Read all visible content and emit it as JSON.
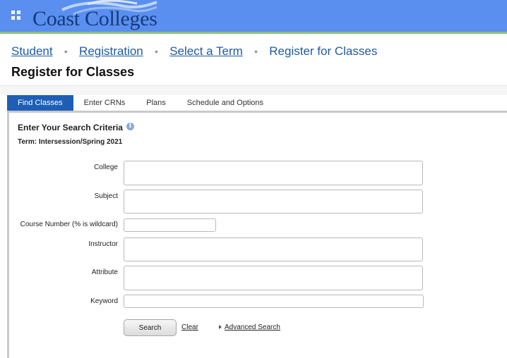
{
  "header": {
    "logo_text": "Coast Colleges",
    "icons": {
      "apps": "grid-apps-icon",
      "logo": "waves-logo-icon"
    },
    "colors": {
      "bar": "#5a8ff0",
      "stripe": "#8fc07a",
      "logo_text": "#163a7a"
    }
  },
  "breadcrumb": {
    "items": [
      "Student",
      "Registration",
      "Select a Term"
    ],
    "current": "Register for Classes"
  },
  "page": {
    "title": "Register for Classes"
  },
  "tabs": [
    {
      "label": "Find Classes",
      "active": true
    },
    {
      "label": "Enter CRNs",
      "active": false
    },
    {
      "label": "Plans",
      "active": false
    },
    {
      "label": "Schedule and Options",
      "active": false
    }
  ],
  "search": {
    "title": "Enter Your Search Criteria",
    "info_icon": "info-icon",
    "term": "Term: Intersession/Spring 2021",
    "fields": {
      "college": {
        "label": "College",
        "value": ""
      },
      "subject": {
        "label": "Subject",
        "value": ""
      },
      "course_number": {
        "label": "Course Number (% is wildcard)",
        "value": ""
      },
      "instructor": {
        "label": "Instructor",
        "value": ""
      },
      "attribute": {
        "label": "Attribute",
        "value": ""
      },
      "keyword": {
        "label": "Keyword",
        "value": ""
      }
    },
    "search_button": "Search",
    "clear_link": "Clear",
    "advanced_link": "Advanced Search"
  },
  "colors": {
    "accent": "#1f5eb5",
    "link": "#1f5aa6"
  }
}
